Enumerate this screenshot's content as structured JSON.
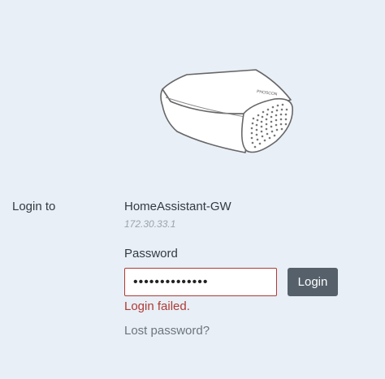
{
  "device_image": {
    "icon": "router-device-icon",
    "brand_text": "PHOSCON"
  },
  "login": {
    "label": "Login to",
    "hostname": "HomeAssistant-GW",
    "ip": "172.30.33.1"
  },
  "form": {
    "password_label": "Password",
    "password_value": "••••••••••••••",
    "login_button": "Login",
    "error_message": "Login failed.",
    "lost_password": "Lost password?"
  },
  "colors": {
    "background": "#e8eff6",
    "error": "#b03a35",
    "button": "#55606a"
  }
}
